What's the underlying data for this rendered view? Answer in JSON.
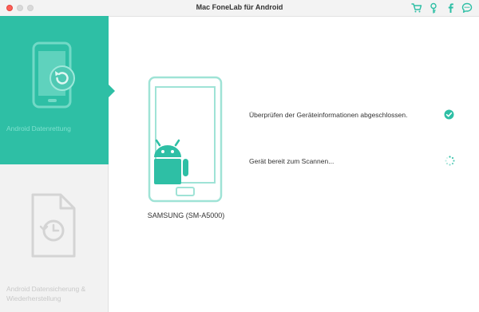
{
  "window": {
    "title": "Mac FoneLab für Android"
  },
  "toolbar": {
    "icons": [
      "cart-icon",
      "key-icon",
      "facebook-icon",
      "chat-icon"
    ],
    "accent": "#2ebfa5"
  },
  "sidebar": {
    "items": [
      {
        "label": "Android Datenrettung",
        "icon": "phone-restore-icon",
        "active": true
      },
      {
        "label": "Android Datensicherung & Wiederherstellung",
        "icon": "file-backup-icon",
        "active": false
      }
    ]
  },
  "main": {
    "device_name": "SAMSUNG (SM-A5000)",
    "statuses": [
      {
        "text": "Überprüfen der Geräteinformationen abgeschlossen.",
        "state": "done",
        "icon": "check-circle-icon"
      },
      {
        "text": "Gerät bereit zum Scannen...",
        "state": "loading",
        "icon": "spinner-icon"
      }
    ]
  },
  "colors": {
    "accent": "#2ebfa5",
    "sidebar_bg": "#f2f2f2",
    "inactive_text": "#c9c9c9"
  }
}
